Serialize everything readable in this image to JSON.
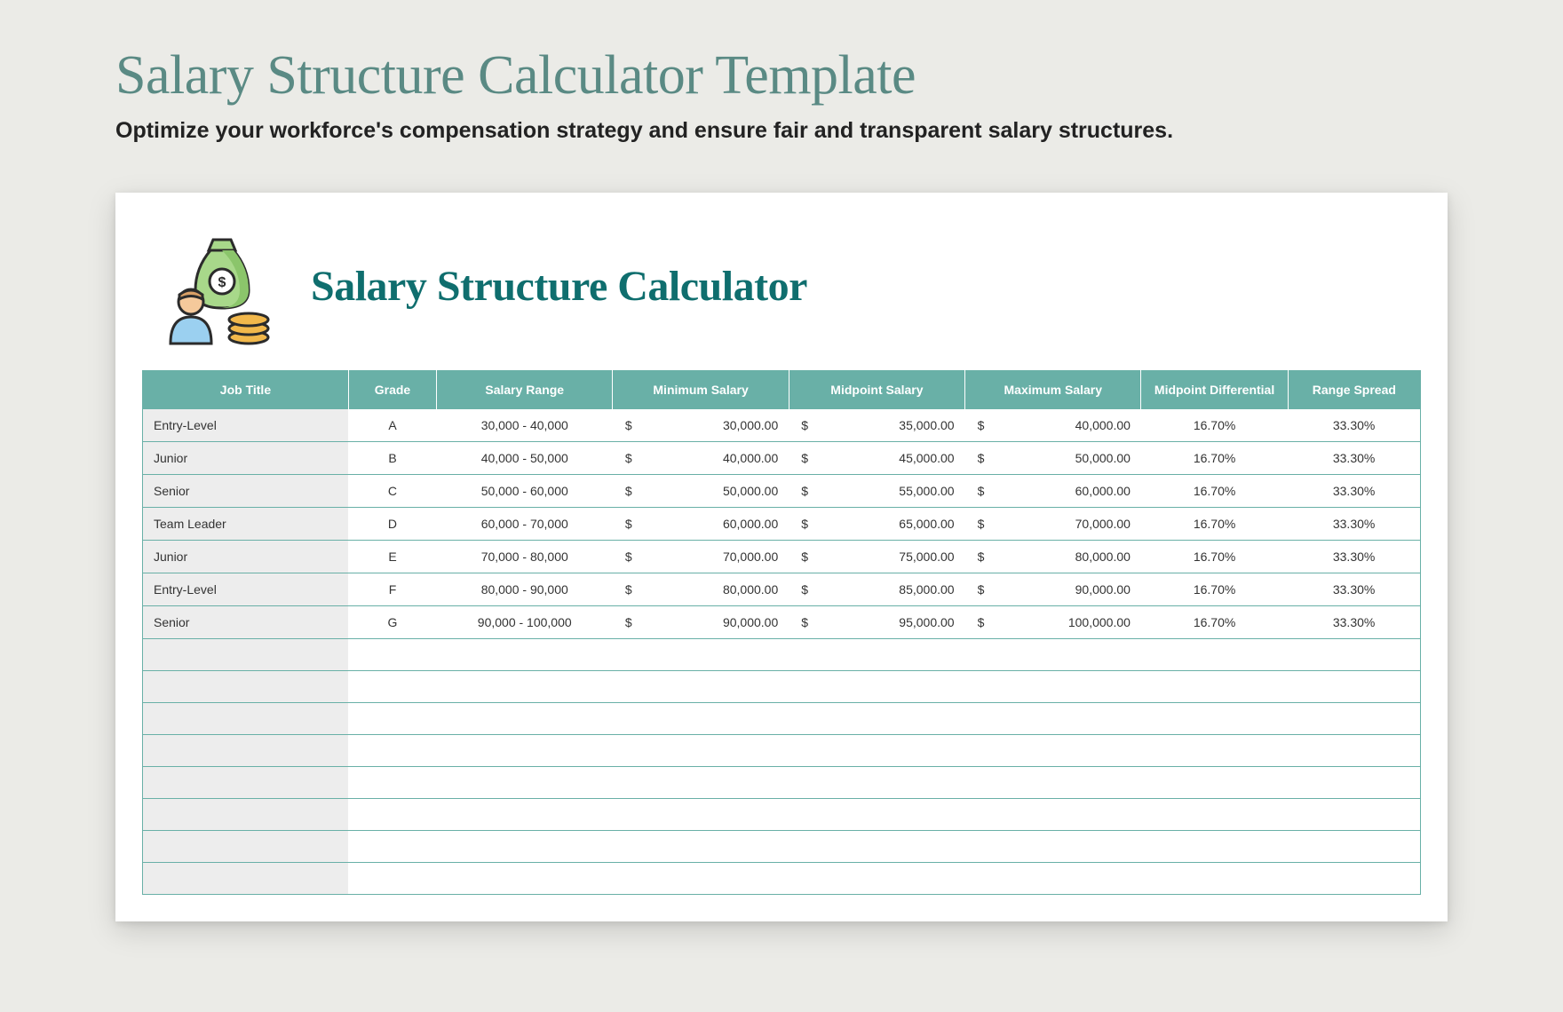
{
  "page": {
    "title": "Salary Structure Calculator Template",
    "subtitle": "Optimize your workforce's compensation strategy and ensure fair and transparent salary structures."
  },
  "card": {
    "title": "Salary Structure Calculator",
    "icon_name": "money-bag-person-icon"
  },
  "table": {
    "headers": {
      "job_title": "Job Title",
      "grade": "Grade",
      "salary_range": "Salary Range",
      "minimum_salary": "Minimum Salary",
      "midpoint_salary": "Midpoint Salary",
      "maximum_salary": "Maximum Salary",
      "midpoint_differential": "Midpoint Differential",
      "range_spread": "Range Spread"
    },
    "currency": "$",
    "rows": [
      {
        "job_title": "Entry-Level",
        "grade": "A",
        "salary_range": "30,000 - 40,000",
        "minimum_salary": "30,000.00",
        "midpoint_salary": "35,000.00",
        "maximum_salary": "40,000.00",
        "midpoint_differential": "16.70%",
        "range_spread": "33.30%"
      },
      {
        "job_title": "Junior",
        "grade": "B",
        "salary_range": "40,000 - 50,000",
        "minimum_salary": "40,000.00",
        "midpoint_salary": "45,000.00",
        "maximum_salary": "50,000.00",
        "midpoint_differential": "16.70%",
        "range_spread": "33.30%"
      },
      {
        "job_title": "Senior",
        "grade": "C",
        "salary_range": "50,000 - 60,000",
        "minimum_salary": "50,000.00",
        "midpoint_salary": "55,000.00",
        "maximum_salary": "60,000.00",
        "midpoint_differential": "16.70%",
        "range_spread": "33.30%"
      },
      {
        "job_title": "Team Leader",
        "grade": "D",
        "salary_range": "60,000 - 70,000",
        "minimum_salary": "60,000.00",
        "midpoint_salary": "65,000.00",
        "maximum_salary": "70,000.00",
        "midpoint_differential": "16.70%",
        "range_spread": "33.30%"
      },
      {
        "job_title": "Junior",
        "grade": "E",
        "salary_range": "70,000 - 80,000",
        "minimum_salary": "70,000.00",
        "midpoint_salary": "75,000.00",
        "maximum_salary": "80,000.00",
        "midpoint_differential": "16.70%",
        "range_spread": "33.30%"
      },
      {
        "job_title": "Entry-Level",
        "grade": "F",
        "salary_range": "80,000 - 90,000",
        "minimum_salary": "80,000.00",
        "midpoint_salary": "85,000.00",
        "maximum_salary": "90,000.00",
        "midpoint_differential": "16.70%",
        "range_spread": "33.30%"
      },
      {
        "job_title": "Senior",
        "grade": "G",
        "salary_range": "90,000 - 100,000",
        "minimum_salary": "90,000.00",
        "midpoint_salary": "95,000.00",
        "maximum_salary": "100,000.00",
        "midpoint_differential": "16.70%",
        "range_spread": "33.30%"
      }
    ],
    "empty_rows": 8
  },
  "chart_data": {
    "type": "table",
    "title": "Salary Structure Calculator",
    "columns": [
      "Job Title",
      "Grade",
      "Salary Range",
      "Minimum Salary",
      "Midpoint Salary",
      "Maximum Salary",
      "Midpoint Differential",
      "Range Spread"
    ],
    "rows": [
      [
        "Entry-Level",
        "A",
        "30,000 - 40,000",
        30000.0,
        35000.0,
        40000.0,
        16.7,
        33.3
      ],
      [
        "Junior",
        "B",
        "40,000 - 50,000",
        40000.0,
        45000.0,
        50000.0,
        16.7,
        33.3
      ],
      [
        "Senior",
        "C",
        "50,000 - 60,000",
        50000.0,
        55000.0,
        60000.0,
        16.7,
        33.3
      ],
      [
        "Team Leader",
        "D",
        "60,000 - 70,000",
        60000.0,
        65000.0,
        70000.0,
        16.7,
        33.3
      ],
      [
        "Junior",
        "E",
        "70,000 - 80,000",
        70000.0,
        75000.0,
        80000.0,
        16.7,
        33.3
      ],
      [
        "Entry-Level",
        "F",
        "80,000 - 90,000",
        80000.0,
        85000.0,
        90000.0,
        16.7,
        33.3
      ],
      [
        "Senior",
        "G",
        "90,000 - 100,000",
        90000.0,
        95000.0,
        100000.0,
        16.7,
        33.3
      ]
    ]
  },
  "colors": {
    "accent_teal": "#69b0a7",
    "title_teal": "#5a8a84",
    "card_title_teal": "#0f6e6e",
    "background": "#ebebe7",
    "row_label_bg": "#ededed"
  }
}
